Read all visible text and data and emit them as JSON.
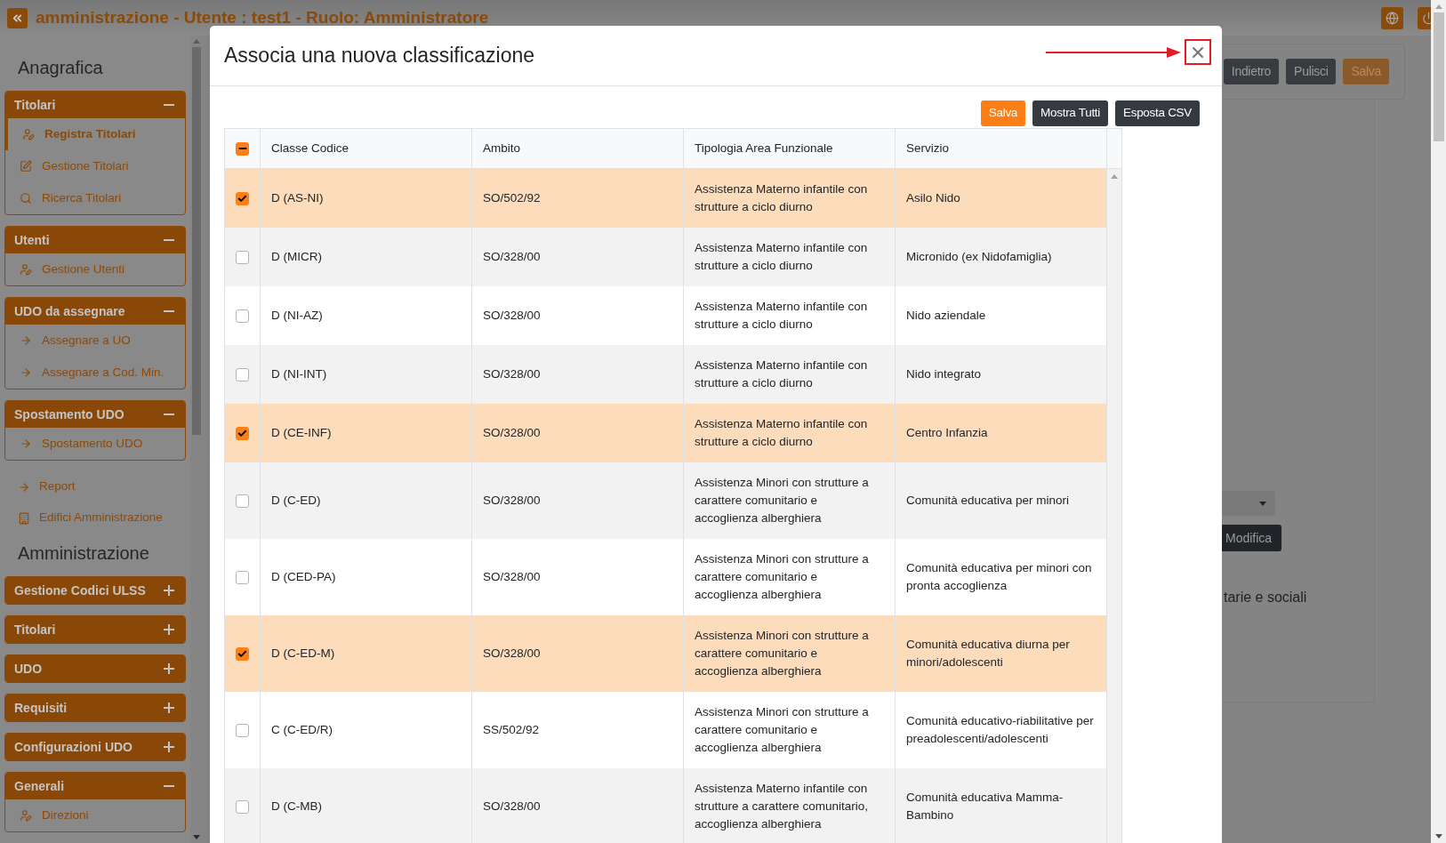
{
  "header": {
    "title": "amministrazione - Utente : test1 - Ruolo: Amministratore"
  },
  "sidebar": [
    {
      "kind": "heading",
      "label": "Anagrafica"
    },
    {
      "kind": "group",
      "label": "Titolari",
      "expanded": true,
      "items": [
        {
          "label": "Registra Titolari",
          "kind": "user",
          "selected": true
        },
        {
          "label": "Gestione Titolari",
          "kind": "edit",
          "selected": false
        },
        {
          "label": "Ricerca Titolari",
          "kind": "search",
          "selected": false
        }
      ]
    },
    {
      "kind": "group",
      "label": "Utenti",
      "expanded": true,
      "items": [
        {
          "label": "Gestione Utenti",
          "kind": "user",
          "selected": false
        }
      ]
    },
    {
      "kind": "group",
      "label": "UDO da assegnare",
      "expanded": true,
      "items": [
        {
          "label": "Assegnare a UO",
          "kind": "arrow",
          "selected": false
        },
        {
          "label": "Assegnare a Cod. Min.",
          "kind": "arrow",
          "selected": false
        }
      ]
    },
    {
      "kind": "group",
      "label": "Spostamento UDO",
      "expanded": true,
      "items": [
        {
          "label": "Spostamento UDO",
          "kind": "arrow",
          "selected": false
        }
      ]
    },
    {
      "kind": "link",
      "label": "Report"
    },
    {
      "kind": "building",
      "label": "Edifici Amministrazione"
    },
    {
      "kind": "heading",
      "label": "Amministrazione"
    },
    {
      "kind": "group",
      "label": "Gestione Codici ULSS",
      "expanded": false
    },
    {
      "kind": "group",
      "label": "Titolari",
      "expanded": false
    },
    {
      "kind": "group",
      "label": "UDO",
      "expanded": false
    },
    {
      "kind": "group",
      "label": "Requisiti",
      "expanded": false
    },
    {
      "kind": "group",
      "label": "Configurazioni UDO",
      "expanded": false
    },
    {
      "kind": "group",
      "label": "Generali",
      "expanded": true,
      "items": [
        {
          "label": "Direzioni",
          "kind": "user",
          "selected": false
        }
      ]
    }
  ],
  "background": {
    "toolbar_buttons": [
      {
        "label": "Indietro",
        "kind": "dark"
      },
      {
        "label": "Pulisci",
        "kind": "dark"
      },
      {
        "label": "Salva",
        "kind": "primary"
      }
    ],
    "edit_button": "Modifica",
    "section_text": "tarie e sociali"
  },
  "modal": {
    "title": "Associa una nuova classificazione",
    "buttons": [
      {
        "label": "Salva",
        "kind": "primary"
      },
      {
        "label": "Mostra Tutti",
        "kind": "dark"
      },
      {
        "label": "Esposta CSV",
        "kind": "dark"
      }
    ],
    "table": {
      "select_all": {
        "indeterminate": true
      },
      "columns": [
        "Classe Codice",
        "Ambito",
        "Tipologia Area Funzionale",
        "Servizio"
      ],
      "rows": [
        {
          "classe": "D (AS-NI)",
          "ambito": "SO/502/92",
          "tipologia": "Assistenza Materno infantile con strutture a ciclo diurno",
          "servizio": "Asilo Nido",
          "selected": true
        },
        {
          "classe": "D (MICR)",
          "ambito": "SO/328/00",
          "tipologia": "Assistenza Materno infantile con strutture a ciclo diurno",
          "servizio": "Micronido (ex Nidofamiglia)",
          "selected": false
        },
        {
          "classe": "D (NI-AZ)",
          "ambito": "SO/328/00",
          "tipologia": "Assistenza Materno infantile con strutture a ciclo diurno",
          "servizio": "Nido aziendale",
          "selected": false
        },
        {
          "classe": "D (NI-INT)",
          "ambito": "SO/328/00",
          "tipologia": "Assistenza Materno infantile con strutture a ciclo diurno",
          "servizio": "Nido integrato",
          "selected": false
        },
        {
          "classe": "D (CE-INF)",
          "ambito": "SO/328/00",
          "tipologia": "Assistenza Materno infantile con strutture a ciclo diurno",
          "servizio": "Centro Infanzia",
          "selected": true
        },
        {
          "classe": "D (C-ED)",
          "ambito": "SO/328/00",
          "tipologia": "Assistenza Minori con strutture a carattere comunitario e accoglienza alberghiera",
          "servizio": "Comunità educativa per minori",
          "selected": false
        },
        {
          "classe": "D (CED-PA)",
          "ambito": "SO/328/00",
          "tipologia": "Assistenza Minori con strutture a carattere comunitario e accoglienza alberghiera",
          "servizio": "Comunità educativa per minori con pronta accoglienza",
          "selected": false
        },
        {
          "classe": "D (C-ED-M)",
          "ambito": "SO/328/00",
          "tipologia": "Assistenza Minori con strutture a carattere comunitario e accoglienza alberghiera",
          "servizio": "Comunità educativa diurna per minori/adolescenti",
          "selected": true
        },
        {
          "classe": "C (C-ED/R)",
          "ambito": "SS/502/92",
          "tipologia": "Assistenza Minori con strutture a carattere comunitario e accoglienza alberghiera",
          "servizio": "Comunità educativo-riabilitative per preadolescenti/adolescenti",
          "selected": false
        },
        {
          "classe": "D (C-MB)",
          "ambito": "SO/328/00",
          "tipologia": "Assistenza Materno infantile con strutture a carattere comunitario, accoglienza alberghiera",
          "servizio": "Comunità educativa Mamma-Bambino",
          "selected": false
        }
      ]
    }
  }
}
